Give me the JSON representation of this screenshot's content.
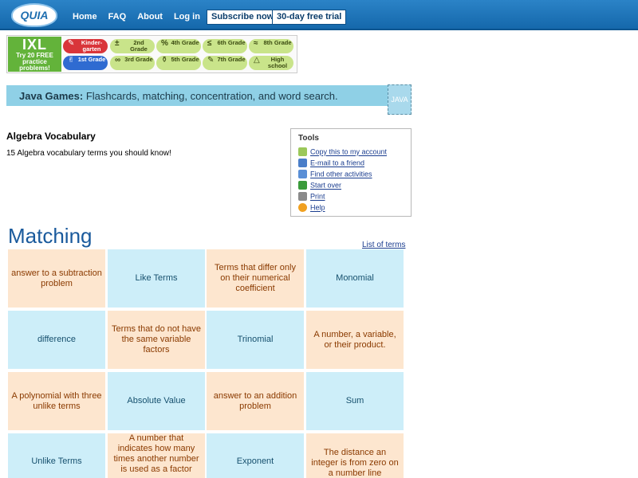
{
  "header": {
    "logo": "QUIA",
    "nav": [
      "Home",
      "FAQ",
      "About",
      "Log in"
    ],
    "subscribe": "Subscribe now",
    "trial": "30-day free trial"
  },
  "ad": {
    "brand": "IXL",
    "tagline": "Try 20 FREE practice problems!",
    "grades": [
      {
        "label": "Kinder-garten",
        "icon": "✎"
      },
      {
        "label": "1st Grade",
        "icon": "✌"
      },
      {
        "label": "2nd Grade",
        "icon": "±"
      },
      {
        "label": "3rd Grade",
        "icon": "∞"
      },
      {
        "label": "4th Grade",
        "icon": "%"
      },
      {
        "label": "5th Grade",
        "icon": "⚱"
      },
      {
        "label": "6th Grade",
        "icon": "≤"
      },
      {
        "label": "7th Grade",
        "icon": "✎"
      },
      {
        "label": "8th Grade",
        "icon": "≈"
      },
      {
        "label": "High school",
        "icon": "△"
      }
    ]
  },
  "banner": {
    "bold": "Java Games:",
    "rest": " Flashcards, matching, concentration, and word search.",
    "icon_text": "JAVA"
  },
  "activity": {
    "title": "Algebra Vocabulary",
    "description": "15 Algebra vocabulary terms you should know!"
  },
  "tools": {
    "title": "Tools",
    "items": [
      {
        "label": "Copy this to my account",
        "icon": "copy-icon",
        "color": "#9bc85a"
      },
      {
        "label": "E-mail to a friend",
        "icon": "email-icon",
        "color": "#4a7ec9"
      },
      {
        "label": "Find other activities",
        "icon": "search-icon",
        "color": "#5a8fd6"
      },
      {
        "label": "Start over",
        "icon": "rewind-icon",
        "color": "#3a9a3a"
      },
      {
        "label": "Print",
        "icon": "printer-icon",
        "color": "#8a8a8a"
      },
      {
        "label": "Help",
        "icon": "help-icon",
        "color": "#f0a020"
      }
    ]
  },
  "matching": {
    "title": "Matching",
    "list_link": "List of terms",
    "cards": [
      {
        "text": "answer to a subtraction problem",
        "kind": "peach"
      },
      {
        "text": "Like Terms",
        "kind": "blue"
      },
      {
        "text": "Terms that differ only on their numerical coefficient",
        "kind": "peach"
      },
      {
        "text": "Monomial",
        "kind": "blue"
      },
      {
        "text": "difference",
        "kind": "blue"
      },
      {
        "text": "Terms that do not have the same variable factors",
        "kind": "peach"
      },
      {
        "text": "Trinomial",
        "kind": "blue"
      },
      {
        "text": "A number, a variable, or their product.",
        "kind": "peach"
      },
      {
        "text": "A polynomial with three unlike terms",
        "kind": "peach"
      },
      {
        "text": "Absolute Value",
        "kind": "blue"
      },
      {
        "text": "answer to an addition problem",
        "kind": "peach"
      },
      {
        "text": "Sum",
        "kind": "blue"
      },
      {
        "text": "Unlike Terms",
        "kind": "blue"
      },
      {
        "text": "A number that indicates how many times another number is used as a factor",
        "kind": "peach"
      },
      {
        "text": "Exponent",
        "kind": "blue"
      },
      {
        "text": "The distance an integer is from zero on a number line",
        "kind": "peach"
      }
    ]
  }
}
